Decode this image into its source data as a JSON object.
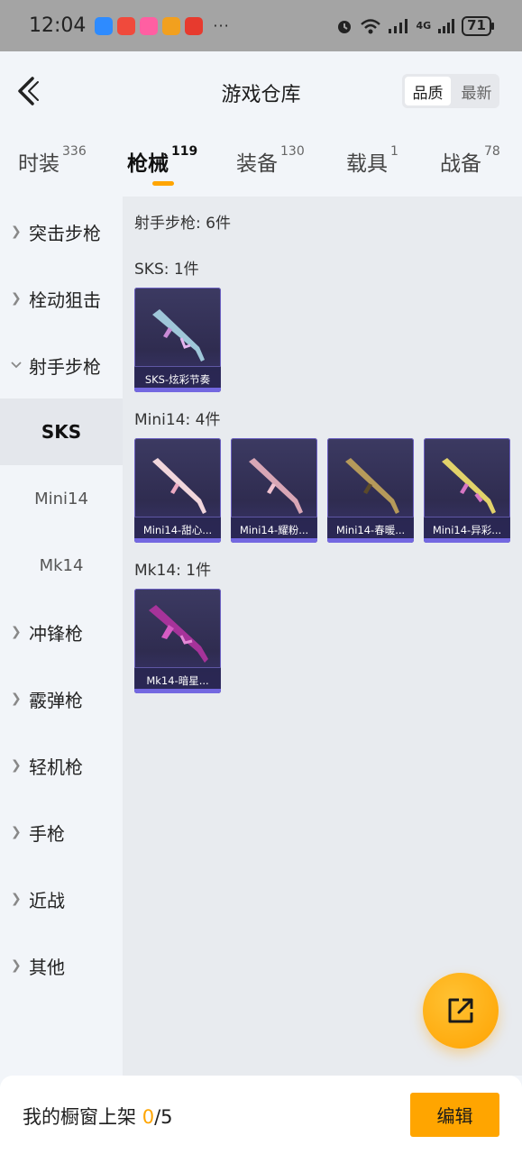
{
  "status_bar": {
    "time": "12:04",
    "more": "···",
    "network": "4G",
    "battery": "71"
  },
  "header": {
    "title": "游戏仓库",
    "sort_options": [
      "品质",
      "最新"
    ],
    "active_sort": "品质"
  },
  "tabs": [
    {
      "label": "时装",
      "count": "336"
    },
    {
      "label": "枪械",
      "count": "119"
    },
    {
      "label": "装备",
      "count": "130"
    },
    {
      "label": "载具",
      "count": "1"
    },
    {
      "label": "战备",
      "count": "78"
    }
  ],
  "active_tab": "枪械",
  "sidebar": {
    "categories": [
      {
        "label": "突击步枪"
      },
      {
        "label": "栓动狙击"
      },
      {
        "label": "射手步枪"
      },
      {
        "label": "冲锋枪"
      },
      {
        "label": "霰弹枪"
      },
      {
        "label": "轻机枪"
      },
      {
        "label": "手枪"
      },
      {
        "label": "近战"
      },
      {
        "label": "其他"
      }
    ],
    "subcategories": [
      {
        "label": "SKS"
      },
      {
        "label": "Mini14"
      },
      {
        "label": "Mk14"
      }
    ],
    "active_subcategory": "SKS"
  },
  "content": {
    "section_title": "射手步枪: 6件",
    "groups": [
      {
        "title": "SKS: 1件",
        "items": [
          {
            "name": "SKS-炫彩节奏"
          }
        ]
      },
      {
        "title": "Mini14: 4件",
        "items": [
          {
            "name": "Mini14-甜心..."
          },
          {
            "name": "Mini14-耀粉..."
          },
          {
            "name": "Mini14-春暖..."
          },
          {
            "name": "Mini14-异彩..."
          }
        ]
      },
      {
        "title": "Mk14: 1件",
        "items": [
          {
            "name": "Mk14-暗星..."
          }
        ]
      }
    ]
  },
  "bottom_bar": {
    "label": "我的橱窗上架",
    "count": "0",
    "total": "/5",
    "edit_label": "编辑"
  },
  "colors": {
    "accent": "#ffa500",
    "card_bg": "#332f58",
    "card_border": "#6a5fc0"
  }
}
